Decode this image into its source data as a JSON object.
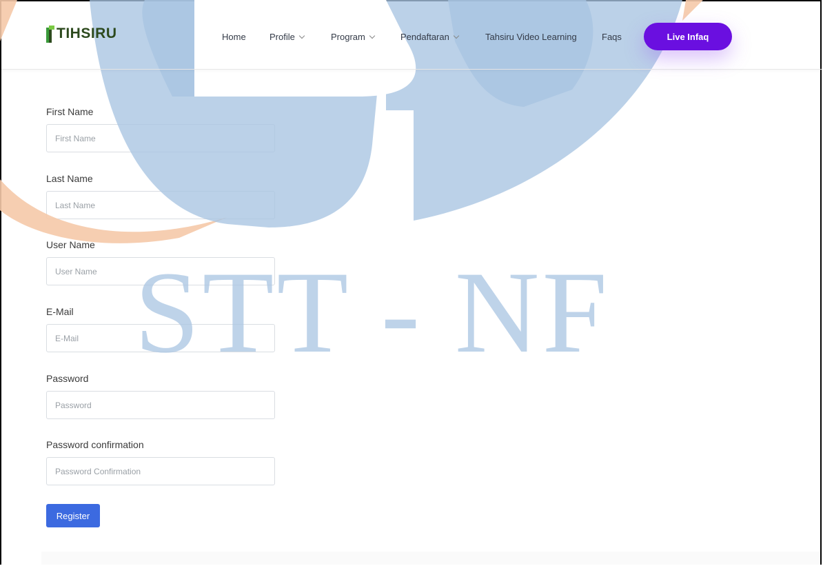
{
  "header": {
    "logo_text": "IHSIRU",
    "logo_initial": "T",
    "nav": [
      {
        "label": "Home",
        "dropdown": false
      },
      {
        "label": "Profile",
        "dropdown": true
      },
      {
        "label": "Program",
        "dropdown": true
      },
      {
        "label": "Pendaftaran",
        "dropdown": true
      },
      {
        "label": "Tahsiru Video Learning",
        "dropdown": false
      },
      {
        "label": "Faqs",
        "dropdown": false
      }
    ],
    "cta_label": "Live Infaq"
  },
  "form": {
    "fields": [
      {
        "label": "First Name",
        "placeholder": "First Name"
      },
      {
        "label": "Last Name",
        "placeholder": "Last Name"
      },
      {
        "label": "User Name",
        "placeholder": "User Name"
      },
      {
        "label": "E-Mail",
        "placeholder": "E-Mail"
      },
      {
        "label": "Password",
        "placeholder": "Password"
      },
      {
        "label": "Password confirmation",
        "placeholder": "Password Confirmation"
      }
    ],
    "submit_label": "Register"
  },
  "watermark": {
    "text": "STT - NF"
  },
  "colors": {
    "accent": "#6a0fe0",
    "button": "#3c6ae0",
    "watermark_blue": "#a8c4e2",
    "watermark_orange": "#f5c9a8"
  }
}
